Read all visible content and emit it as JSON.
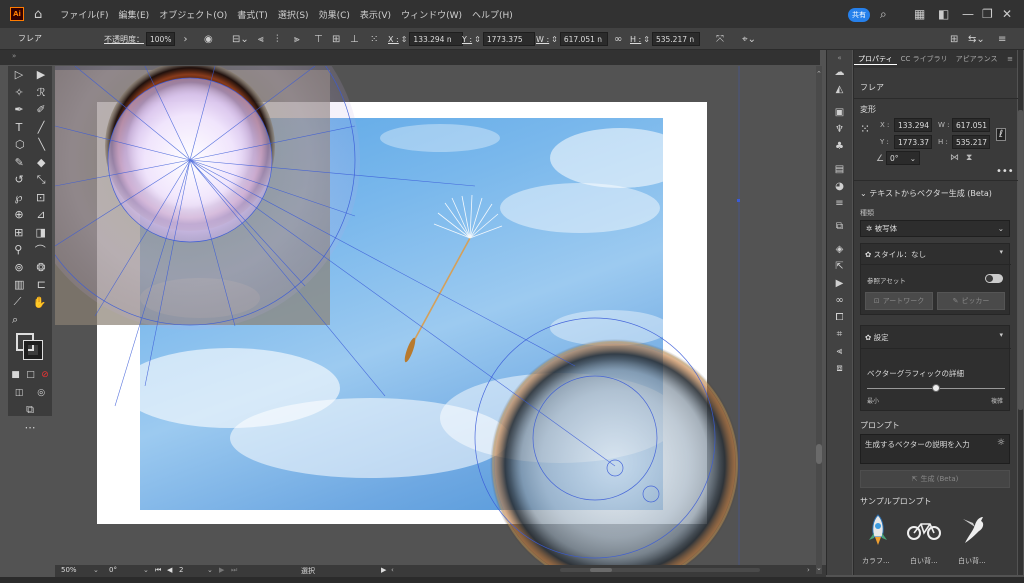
{
  "menubar": {
    "logo": "Ai",
    "items": [
      "ファイル(F)",
      "編集(E)",
      "オブジェクト(O)",
      "書式(T)",
      "選択(S)",
      "効果(C)",
      "表示(V)",
      "ウィンドウ(W)",
      "ヘルプ(H)"
    ],
    "share_label": "共有"
  },
  "controlbar": {
    "selection_label": "フレア",
    "opacity_label": "不透明度：",
    "opacity_value": "100%",
    "x_label": "X :",
    "x_value": "133.294 n",
    "y_label": "Y :",
    "y_value": "1773.375",
    "w_label": "W :",
    "w_value": "617.051 n",
    "h_label": "H :",
    "h_value": "535.217 n"
  },
  "status": {
    "zoom": "50%",
    "angle": "0°",
    "artboard_number": "2",
    "tool": "選択"
  },
  "panel": {
    "tabs": [
      "プロパティ",
      "CC ライブラリ",
      "アピアランス"
    ],
    "object_name": "フレア",
    "transform_title": "変形",
    "x_label": "X :",
    "x_value": "133.294",
    "y_label": "Y :",
    "y_value": "1773.37",
    "w_label": "W :",
    "w_value": "617.051",
    "h_label": "H :",
    "h_value": "535.217",
    "angle_value": "0°",
    "t2v_title": "テキストからベクター生成 (Beta)",
    "type_label": "種類",
    "type_value": "被写体",
    "style_label": "スタイル：なし",
    "ref_asset_label": "参照アセット",
    "artwork_btn": "アートワーク",
    "picker_btn": "ピッカー",
    "settings_label": "設定",
    "detail_label": "ベクターグラフィックの詳細",
    "detail_min": "最小",
    "detail_max": "複雑",
    "detail_value": 0.5,
    "prompt_label": "プロンプト",
    "prompt_placeholder": "生成するベクターの説明を入力",
    "generate_btn": "生成 (Beta)",
    "samples_title": "サンプルプロンプト",
    "samples": [
      "カラフ...",
      "白い背...",
      "白い背..."
    ]
  },
  "colors": {
    "accent": "#2680eb",
    "logo_orange": "#ff7c00",
    "guide_blue": "#3a5bd8"
  }
}
